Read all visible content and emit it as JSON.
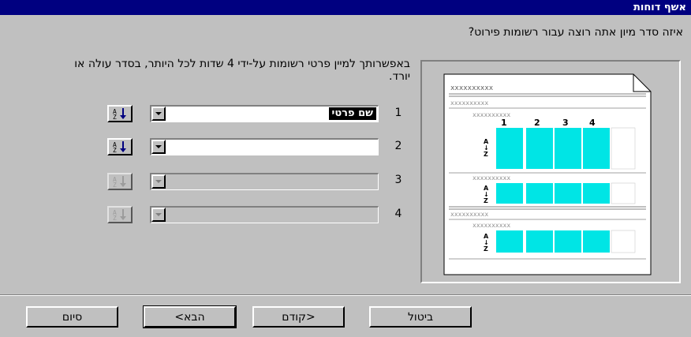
{
  "window": {
    "title": "אשף דוחות"
  },
  "question": "איזה סדר מיון אתה רוצה עבור רשומות פירוט?",
  "description": "באפשרותך למיין פרטי רשומות על-ידי 4 שדות לכל היותר, בסדר עולה או יורד.",
  "sort_rows": [
    {
      "number": "1",
      "value": "שם פרטי",
      "enabled": true
    },
    {
      "number": "2",
      "value": "",
      "enabled": true
    },
    {
      "number": "3",
      "value": "",
      "enabled": false
    },
    {
      "number": "4",
      "value": "",
      "enabled": false
    }
  ],
  "sort_button_icon": "sort-ascending-icon",
  "preview": {
    "placeholder": "xxxxxxxxxx",
    "columns": [
      "1",
      "2",
      "3",
      "4"
    ],
    "colors": {
      "highlight": "#00e5e5",
      "paper": "#ffffff"
    }
  },
  "buttons": {
    "finish": "סיום",
    "next": "הבא>",
    "back": "<קודם",
    "cancel": "ביטול"
  }
}
